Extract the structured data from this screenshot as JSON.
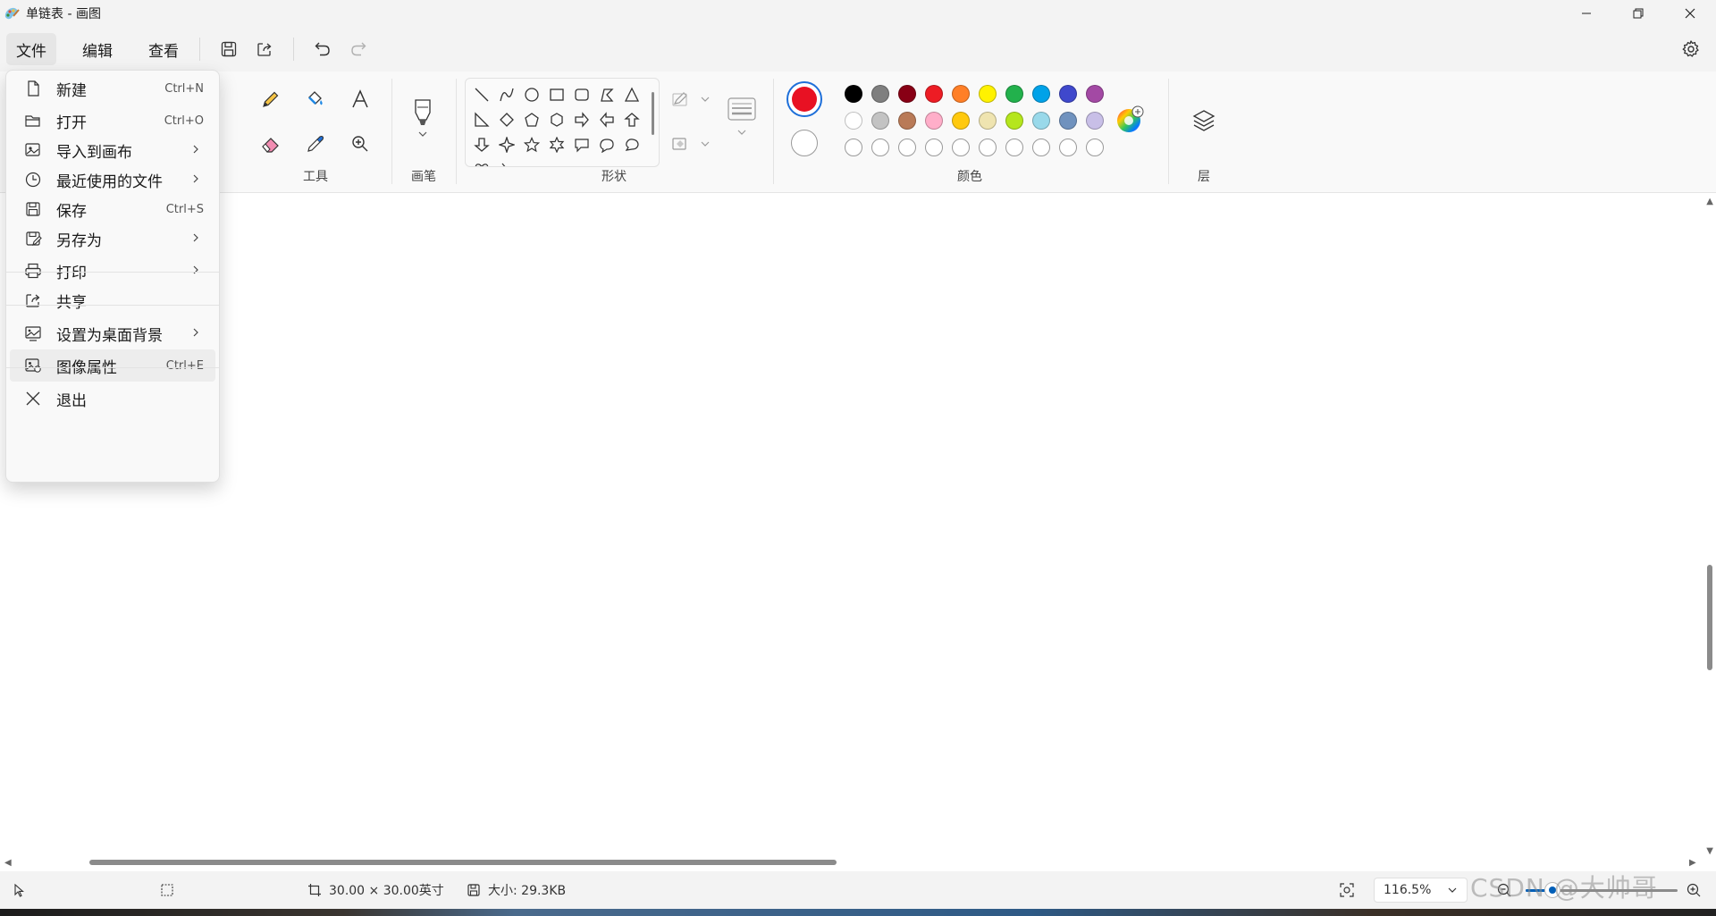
{
  "window": {
    "title": "单链表 - 画图"
  },
  "menu": {
    "file": "文件",
    "edit": "编辑",
    "view": "查看"
  },
  "ribbon": {
    "groups": {
      "tools": "工具",
      "brush": "画笔",
      "shapes": "形状",
      "colors": "颜色",
      "layers": "层"
    }
  },
  "colors": {
    "primary": "#e81123",
    "secondary": "#ffffff",
    "palette_row1": [
      "#000000",
      "#7f7f7f",
      "#880015",
      "#ed1c24",
      "#ff7f27",
      "#fff200",
      "#22b14c",
      "#00a2e8",
      "#3f48cc",
      "#a349a4"
    ],
    "palette_row2": [
      "#ffffff",
      "#c3c3c3",
      "#b97a57",
      "#ffaec9",
      "#ffc90e",
      "#efe4b0",
      "#b5e61d",
      "#99d9ea",
      "#7092be",
      "#c8bfe7"
    ]
  },
  "file_menu": {
    "items": [
      {
        "label": "新建",
        "shortcut": "Ctrl+N",
        "icon": "new-file-icon"
      },
      {
        "label": "打开",
        "shortcut": "Ctrl+O",
        "icon": "folder-open-icon"
      },
      {
        "label": "导入到画布",
        "shortcut": "",
        "icon": "import-image-icon",
        "submenu": true
      },
      {
        "label": "最近使用的文件",
        "shortcut": "",
        "icon": "clock-icon",
        "submenu": true
      },
      {
        "label": "保存",
        "shortcut": "Ctrl+S",
        "icon": "save-icon"
      },
      {
        "label": "另存为",
        "shortcut": "",
        "icon": "save-as-icon",
        "submenu": true
      },
      {
        "label": "打印",
        "shortcut": "",
        "icon": "printer-icon",
        "submenu": true
      },
      {
        "label": "共享",
        "shortcut": "",
        "icon": "share-icon"
      },
      {
        "label": "设置为桌面背景",
        "shortcut": "",
        "icon": "desktop-background-icon",
        "submenu": true
      },
      {
        "label": "图像属性",
        "shortcut": "Ctrl+E",
        "icon": "image-properties-icon"
      },
      {
        "label": "退出",
        "shortcut": "",
        "icon": "close-icon"
      }
    ]
  },
  "status": {
    "canvas_size": "30.00 × 30.00英寸",
    "file_size": "大小: 29.3KB",
    "zoom": "116.5%"
  },
  "watermark": "CSDN @大帅哥"
}
